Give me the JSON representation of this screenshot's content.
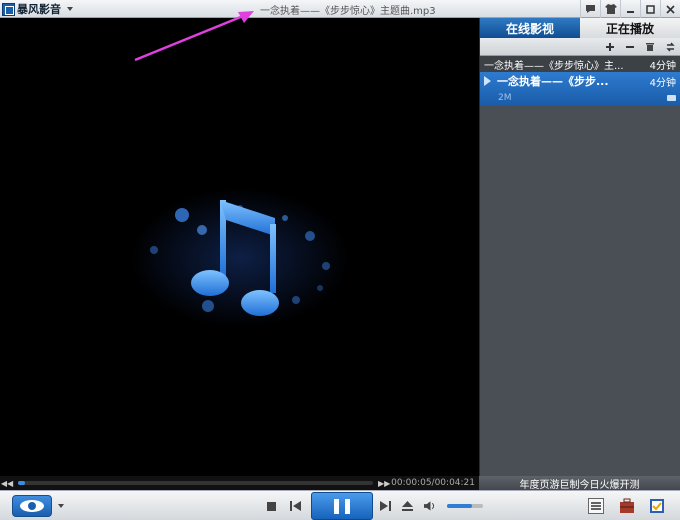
{
  "app": {
    "brand": "暴风影音",
    "window_title": "一念执着——《步步惊心》主题曲.mp3"
  },
  "panel": {
    "tabs": [
      {
        "label": "在线影视",
        "active": false
      },
      {
        "label": "正在播放",
        "active": true
      }
    ],
    "playlist": [
      {
        "name": "一念执着——《步步惊心》主...",
        "duration": "4分钟",
        "selected": false
      },
      {
        "name": "一念执着——《步步...",
        "duration": "4分钟",
        "size": "2M",
        "selected": true
      }
    ],
    "ad_text": "年度页游巨制今日火爆开测"
  },
  "playback": {
    "time": "00:00:05/00:04:21",
    "progress": 0.02,
    "volume": 0.7
  },
  "colors": {
    "accent": "#1a5ca8",
    "annotation": "#e040e0",
    "note": "#3f8fe8"
  }
}
